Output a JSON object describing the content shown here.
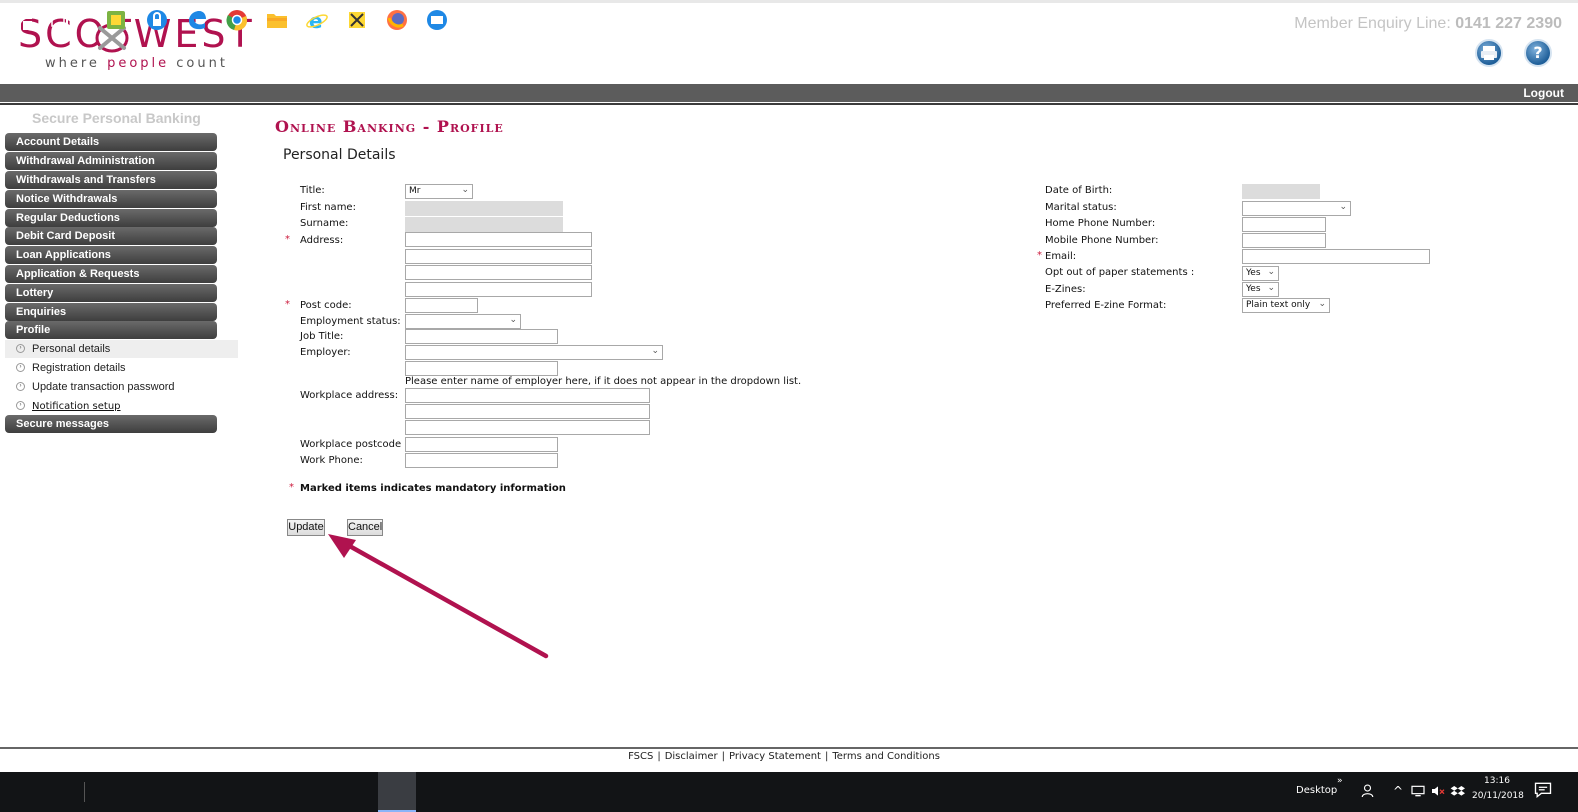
{
  "header": {
    "logo_text": "SCOTWEST",
    "logo_tagline_1": "where ",
    "logo_tagline_2": "people",
    "logo_tagline_3": " count",
    "enquiry_label": "Member Enquiry Line: ",
    "enquiry_number": "0141 227 2390",
    "print_icon": "printer-icon",
    "help_icon": "help-icon",
    "help_glyph": "?",
    "logout": "Logout"
  },
  "sidebar": {
    "title": "Secure Personal Banking",
    "items": [
      {
        "label": "Account Details"
      },
      {
        "label": "Withdrawal Administration"
      },
      {
        "label": "Withdrawals and Transfers"
      },
      {
        "label": "Notice Withdrawals"
      },
      {
        "label": "Regular Deductions"
      },
      {
        "label": "Debit Card Deposit"
      },
      {
        "label": "Loan Applications"
      },
      {
        "label": "Application & Requests"
      },
      {
        "label": "Lottery"
      },
      {
        "label": "Enquiries"
      },
      {
        "label": "Profile"
      }
    ],
    "sub_items": [
      {
        "label": "Personal details"
      },
      {
        "label": "Registration details"
      },
      {
        "label": "Update transaction password"
      },
      {
        "label": "Notification setup"
      }
    ],
    "last_item": "Secure messages"
  },
  "main": {
    "page_title": "Online Banking - Profile",
    "section_title": "Personal Details",
    "left_fields": {
      "title_label": "Title:",
      "title_value": "Mr",
      "first_name_label": "First name:",
      "surname_label": "Surname:",
      "address_label": "Address:",
      "post_code_label": "Post code:",
      "employment_status_label": "Employment status:",
      "job_title_label": "Job Title:",
      "employer_label": "Employer:",
      "employer_hint": "Please enter name of employer here, if it does not appear in the dropdown list.",
      "workplace_address_label": "Workplace address:",
      "workplace_postcode_label": "Workplace postcode :",
      "work_phone_label": "Work Phone:"
    },
    "right_fields": {
      "dob_label": "Date of Birth:",
      "marital_label": "Marital status:",
      "home_phone_label": "Home Phone Number:",
      "mobile_phone_label": "Mobile Phone Number:",
      "email_label": "Email:",
      "paper_label": "Opt out of paper statements :",
      "paper_value": "Yes",
      "ezines_label": "E-Zines:",
      "ezines_value": "Yes",
      "ezine_format_label": "Preferred E-zine Format:",
      "ezine_format_value": "Plain text only"
    },
    "required_marker": "*",
    "mandatory_note": "Marked items indicates mandatory information",
    "update_button": "Update",
    "cancel_button": "Cancel"
  },
  "footer": {
    "links": [
      "FSCS",
      "Disclaimer",
      "Privacy Statement",
      "Terms and Conditions"
    ],
    "separator": "|"
  },
  "taskbar": {
    "desktop_label": "Desktop",
    "time": "13:16",
    "date": "20/11/2018"
  },
  "colors": {
    "brand": "#b0124f",
    "nav_dark": "#4a4a4a",
    "required": "#cc1a3c"
  }
}
